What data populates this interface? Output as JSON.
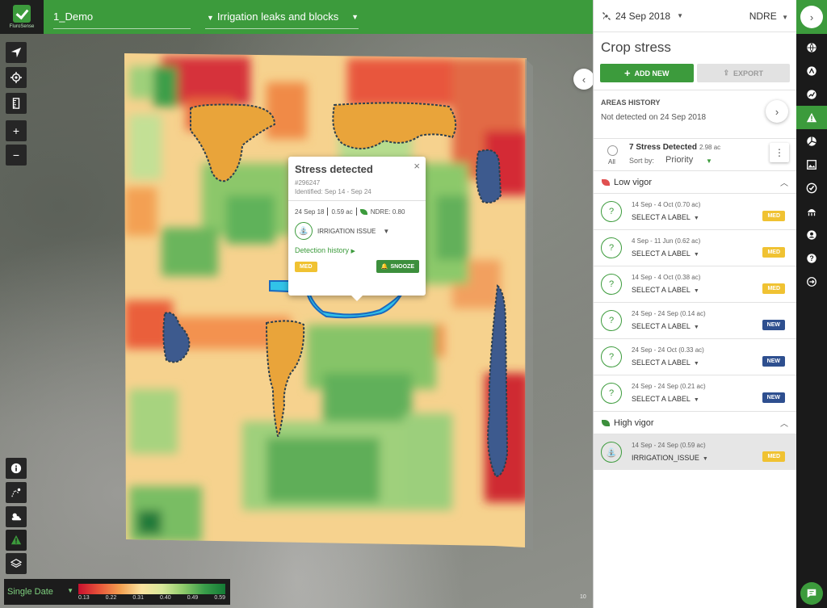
{
  "topbar": {
    "logo_text": "FluroSense",
    "farm": "1_Demo",
    "layer": "Irrigation leaks and blocks"
  },
  "map": {
    "controls": [
      "navigate-icon",
      "locate-icon",
      "ruler-icon",
      "zoom-in-icon",
      "zoom-out-icon"
    ],
    "bottom_controls": [
      "info-icon",
      "draw-icon",
      "weather-icon",
      "alert-icon",
      "layers-icon"
    ],
    "copyright": "10"
  },
  "popup": {
    "title": "Stress detected",
    "id": "#296247",
    "identified": "Identified: Sep 14 - Sep 24",
    "date": "24 Sep 18",
    "area": "0.59 ac",
    "ndre": "NDRE: 0.80",
    "issue": "IRRIGATION ISSUE",
    "history": "Detection history",
    "priority": "MED",
    "snooze": "SNOOZE"
  },
  "legend": {
    "mode": "Single Date",
    "ticks": [
      "0.13",
      "0.22",
      "0.31",
      "0.40",
      "0.49",
      "0.59"
    ]
  },
  "panel": {
    "date": "24 Sep 2018",
    "index": "NDRE",
    "title": "Crop stress",
    "add_new": "ADD NEW",
    "export": "EXPORT",
    "history_title": "AREAS HISTORY",
    "history_sub": "Not detected on 24 Sep 2018",
    "stress_count": "7 Stress Detected",
    "stress_area": "2.98 ac",
    "all_label": "All",
    "sort_label": "Sort by:",
    "sort_value": "Priority",
    "groups": [
      {
        "name": "Low vigor",
        "items": [
          {
            "date": "14 Sep - 4 Oct (0.70 ac)",
            "label": "SELECT A LABEL",
            "badge": "MED"
          },
          {
            "date": "4 Sep - 11 Jun (0.62 ac)",
            "label": "SELECT A LABEL",
            "badge": "MED"
          },
          {
            "date": "14 Sep - 4 Oct (0.38 ac)",
            "label": "SELECT A LABEL",
            "badge": "MED"
          },
          {
            "date": "24 Sep - 24 Sep (0.14 ac)",
            "label": "SELECT A LABEL",
            "badge": "NEW"
          },
          {
            "date": "24 Sep - 24 Oct (0.33 ac)",
            "label": "SELECT A LABEL",
            "badge": "NEW"
          },
          {
            "date": "24 Sep - 24 Sep (0.21 ac)",
            "label": "SELECT A LABEL",
            "badge": "NEW"
          }
        ]
      },
      {
        "name": "High vigor",
        "items": [
          {
            "date": "14 Sep - 24 Sep (0.59 ac)",
            "label": "IRRIGATION_ISSUE",
            "badge": "MED"
          }
        ]
      }
    ]
  },
  "rail": {
    "icons": [
      "globe-icon",
      "farm-icon",
      "analytics-icon",
      "alert-icon",
      "pie-icon",
      "image-icon",
      "check-icon",
      "zones-icon",
      "user-icon",
      "help-icon",
      "logout-icon"
    ]
  },
  "colors": {
    "brand": "#3c9b3c",
    "med": "#f0c232",
    "new": "#2e4f8f"
  }
}
